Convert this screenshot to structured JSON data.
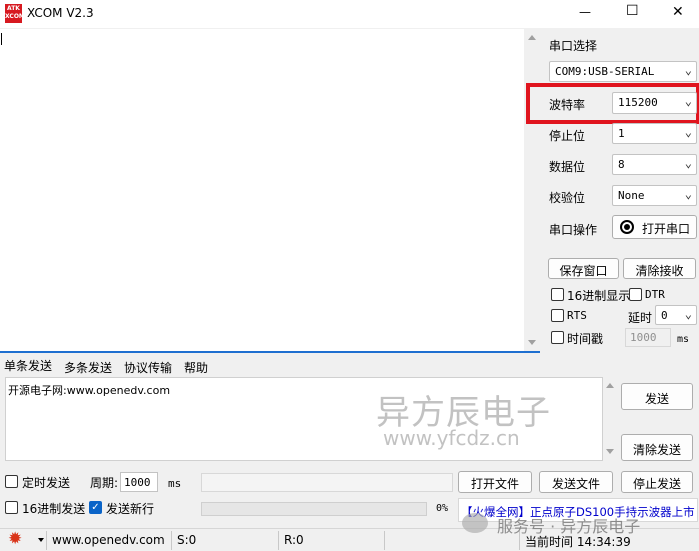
{
  "window": {
    "logo_top": "ATK",
    "logo_bottom": "XCOM",
    "title": "XCOM V2.3",
    "minimize_glyph": "—",
    "maximize_glyph": "☐",
    "close_glyph": "✕"
  },
  "side": {
    "port_select_label": "串口选择",
    "port_value": "COM9:USB-SERIAL",
    "baud_label": "波特率",
    "baud_value": "115200",
    "stopbit_label": "停止位",
    "stopbit_value": "1",
    "databit_label": "数据位",
    "databit_value": "8",
    "parity_label": "校验位",
    "parity_value": "None",
    "port_op_label": "串口操作",
    "open_port_button": "打开串口",
    "save_window_button": "保存窗口",
    "clear_receive_button": "清除接收",
    "hex_display_label": "16进制显示",
    "dtr_label": "DTR",
    "rts_label": "RTS",
    "delay_label": "延时",
    "delay_value": "0",
    "timestamp_label": "时间戳",
    "timestamp_value": "1000",
    "ms_unit": "ms"
  },
  "tabs": [
    "单条发送",
    "多条发送",
    "协议传输",
    "帮助"
  ],
  "send": {
    "text": "开源电子网:www.openedv.com",
    "send_button": "发送",
    "clear_send_button": "清除发送"
  },
  "bottom": {
    "timed_send_label": "定时发送",
    "period_label": "周期:",
    "period_value": "1000",
    "period_unit": "ms",
    "open_file_button": "打开文件",
    "send_file_button": "发送文件",
    "stop_send_button": "停止发送",
    "hex_send_label": "16进制发送",
    "newline_label": "发送新行",
    "progress_text": "0%",
    "progress_fraction": 0,
    "ad_text": "【火爆全网】正点原子DS100手持示波器上市"
  },
  "status": {
    "url": "www.openedv.com",
    "sent": "S:0",
    "received": "R:0",
    "time": "当前时间 14:34:39"
  },
  "watermark": {
    "line1": "异方辰电子",
    "line2": "www.yfcdz.cn",
    "line3": "服务号 · 异方辰电子"
  },
  "accent": {
    "highlight": "#e0141e",
    "link": "#0000cc",
    "check": "#0a64c8"
  }
}
